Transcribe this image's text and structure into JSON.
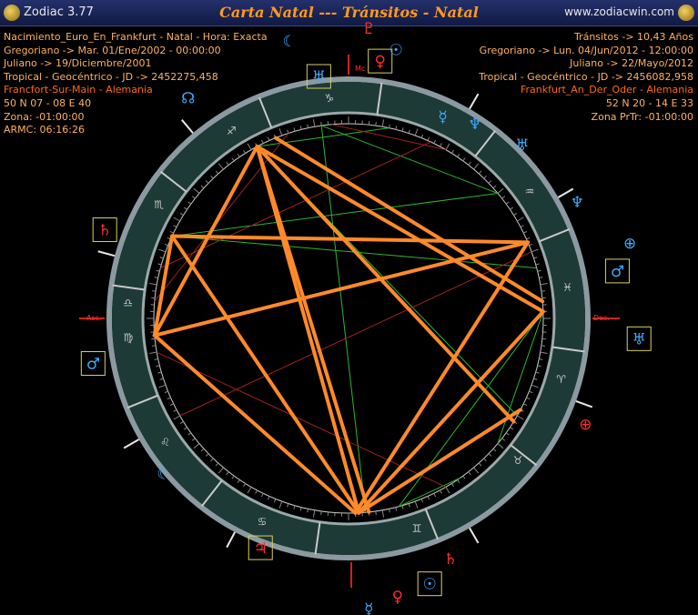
{
  "titlebar": {
    "app_name": "Zodiac 3.77",
    "title": "Carta Natal --- Tránsitos - Natal",
    "url": "www.zodiacwin.com"
  },
  "natal_info": [
    {
      "text": "Nacimiento_Euro_En_Frankfurt - Natal - Hora: Exacta",
      "color": "#ffb060"
    },
    {
      "text": "Gregoriano -> Mar. 01/Ene/2002 - 00:00:00",
      "color": "#ffb060"
    },
    {
      "text": "Juliano -> 19/Diciembre/2001",
      "color": "#ffb060"
    },
    {
      "text": "Tropical - Geocéntrico - JD -> 2452275,458",
      "color": "#ffb060"
    },
    {
      "text": "Francfort-Sur-Main - Alemania",
      "color": "#ff6a10"
    },
    {
      "text": "50 N 07 - 08 E 40",
      "color": "#ffb060"
    },
    {
      "text": "Zona: -01:00:00",
      "color": "#ffb060"
    },
    {
      "text": "ARMC: 06:16:26",
      "color": "#ffb060"
    }
  ],
  "transit_info": [
    {
      "text": "Tránsitos -> 10,43 Años",
      "color": "#ffb060"
    },
    {
      "text": "Gregoriano -> Lun. 04/Jun/2012 - 12:00:00",
      "color": "#ffb060"
    },
    {
      "text": "Juliano -> 22/Mayo/2012",
      "color": "#ffb060"
    },
    {
      "text": "Tropical - Geocéntrico - JD -> 2456082,958",
      "color": "#ffb060"
    },
    {
      "text": "Frankfurt_An_Der_Oder - Alemania",
      "color": "#ff6a10"
    },
    {
      "text": "52 N 20 - 14 E 33",
      "color": "#ffb060"
    },
    {
      "text": "Zona PrTr: -01:00:00",
      "color": "#ffb060"
    }
  ],
  "axes": {
    "asc": "Asc.",
    "des": "Des.",
    "mc": "Mc"
  },
  "colors": {
    "aspect_hard": "#ff8a2a",
    "aspect_soft": "#2fb52f",
    "ring_band": "#1d3a36",
    "frame": "#d8d060"
  },
  "zodiac_signs": [
    {
      "glyph": "♋",
      "angle": 113
    },
    {
      "glyph": "♌",
      "angle": 146
    },
    {
      "glyph": "♍",
      "angle": 175
    },
    {
      "glyph": "♎",
      "angle": 184
    },
    {
      "glyph": "♏",
      "angle": 211
    },
    {
      "glyph": "♐",
      "angle": 238
    },
    {
      "glyph": "♑",
      "angle": 265
    },
    {
      "glyph": "♒",
      "angle": 325
    },
    {
      "glyph": "♓",
      "angle": 352
    },
    {
      "glyph": "♈",
      "angle": 16
    },
    {
      "glyph": "♉",
      "angle": 40
    },
    {
      "glyph": "♊",
      "angle": 72
    }
  ],
  "planets": [
    {
      "name": "jupiter-icon",
      "glyph": "♃",
      "color": "#ff3030",
      "angle": 111,
      "r": 270,
      "boxed": true
    },
    {
      "name": "moon-icon",
      "glyph": "☾",
      "color": "#3fa9ff",
      "angle": 140,
      "r": 265,
      "boxed": false
    },
    {
      "name": "mars-icon",
      "glyph": "♂",
      "color": "#3fa9ff",
      "angle": 170,
      "r": 285,
      "boxed": true
    },
    {
      "name": "saturn-icon",
      "glyph": "♄",
      "color": "#ff3030",
      "angle": 200,
      "r": 285,
      "boxed": true
    },
    {
      "name": "uranus-icon",
      "glyph": "♅",
      "color": "#3fa9ff",
      "angle": 263,
      "r": 268,
      "boxed": true
    },
    {
      "name": "moon-icon-2",
      "glyph": "☾",
      "color": "#3fa9ff",
      "angle": 258,
      "r": 312,
      "boxed": false
    },
    {
      "name": "venus-icon",
      "glyph": "♀",
      "color": "#ff3030",
      "angle": 277,
      "r": 285,
      "boxed": true
    },
    {
      "name": "sun-icon",
      "glyph": "☉",
      "color": "#3fa9ff",
      "angle": 280,
      "r": 300,
      "boxed": false
    },
    {
      "name": "pluto-icon",
      "glyph": "♇",
      "color": "#ff3030",
      "angle": 274,
      "r": 320,
      "boxed": false
    },
    {
      "name": "mercury-icon",
      "glyph": "☿",
      "color": "#3fa9ff",
      "angle": 295,
      "r": 245,
      "boxed": false
    },
    {
      "name": "neptune-icon",
      "glyph": "♆",
      "color": "#3fa9ff",
      "angle": 303,
      "r": 255,
      "boxed": false
    },
    {
      "name": "uranus-icon-2",
      "glyph": "♅",
      "color": "#3fa9ff",
      "angle": 315,
      "r": 270,
      "boxed": false
    },
    {
      "name": "neptune-icon-2",
      "glyph": "♆",
      "color": "#3fa9ff",
      "angle": 333,
      "r": 282,
      "boxed": false
    },
    {
      "name": "mars-icon-2",
      "glyph": "♂",
      "color": "#3fa9ff",
      "angle": 350,
      "r": 300,
      "boxed": true
    },
    {
      "name": "uranus-icon-3",
      "glyph": "♅",
      "color": "#3fa9ff",
      "angle": 4,
      "r": 320,
      "boxed": true
    },
    {
      "name": "saturn-icon-2",
      "glyph": "♄",
      "color": "#ff3030",
      "angle": 67,
      "r": 287,
      "boxed": false
    },
    {
      "name": "sun-icon-2",
      "glyph": "☉",
      "color": "#3fa9ff",
      "angle": 73,
      "r": 305,
      "boxed": true
    },
    {
      "name": "venus-icon-2",
      "glyph": "♀",
      "color": "#ff3030",
      "angle": 80,
      "r": 310,
      "boxed": false
    },
    {
      "name": "mercury-icon-2",
      "glyph": "☿",
      "color": "#3fa9ff",
      "angle": 86,
      "r": 320,
      "boxed": false
    },
    {
      "name": "pof-icon",
      "glyph": "⊕",
      "color": "#ff3030",
      "angle": 24,
      "r": 285,
      "boxed": false
    },
    {
      "name": "pof-icon-2",
      "glyph": "⊕",
      "color": "#3fa9ff",
      "angle": 345,
      "r": 320,
      "boxed": false
    },
    {
      "name": "node-icon",
      "glyph": "☊",
      "color": "#3fa9ff",
      "angle": 234,
      "r": 300,
      "boxed": false
    }
  ]
}
